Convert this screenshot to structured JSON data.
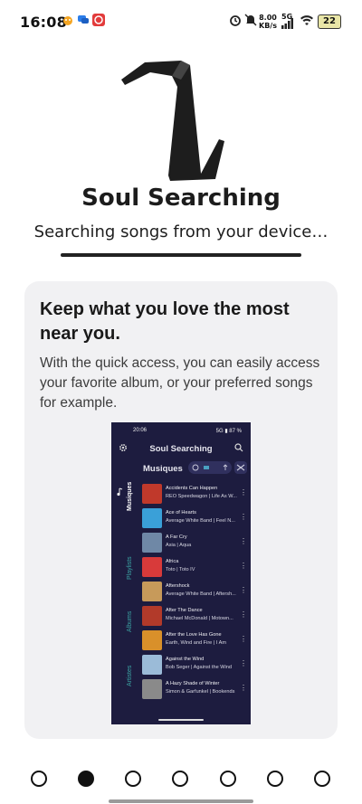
{
  "status_bar": {
    "time": "16:08",
    "net_speed_value": "8.00",
    "net_speed_unit": "KB/s",
    "signal_label": "5G",
    "battery": "22"
  },
  "header": {
    "app_title": "Soul Searching",
    "subtitle": "Searching songs from your device…"
  },
  "card": {
    "title": "Keep what you love the most near you.",
    "description": "With the quick access, you can easily access your favorite album, or your preferred songs for example."
  },
  "preview": {
    "status_time": "20:06",
    "status_right": "5G ▮ 87 %",
    "app_title": "Soul Searching",
    "section_title": "Musiques",
    "side_tabs": [
      "Musiques",
      "Playlists",
      "Albums",
      "Artistes"
    ],
    "songs": [
      {
        "title": "Accidents Can Happen",
        "subtitle": "REO Speedwagon | Life As W...",
        "color": "#c0392b"
      },
      {
        "title": "Ace of Hearts",
        "subtitle": "Average White Band | Feel N...",
        "color": "#3aa0d8"
      },
      {
        "title": "A Far Cry",
        "subtitle": "Asia | Aqua",
        "color": "#6f88a6"
      },
      {
        "title": "Africa",
        "subtitle": "Toto | Toto IV",
        "color": "#d83a3a"
      },
      {
        "title": "Aftershock",
        "subtitle": "Average White Band | Aftersh...",
        "color": "#c79a5a"
      },
      {
        "title": "After The Dance",
        "subtitle": "Michael McDonald | Motown...",
        "color": "#b23a2a"
      },
      {
        "title": "After the Love Has Gone",
        "subtitle": "Earth, Wind and Fire | I Am",
        "color": "#d9902a"
      },
      {
        "title": "Against the Wind",
        "subtitle": "Bob Seger | Against the Wind",
        "color": "#9bbbd8"
      },
      {
        "title": "A Hazy Shade of Winter",
        "subtitle": "Simon & Garfunkel | Bookends",
        "color": "#8a8a8a"
      }
    ]
  },
  "pager": {
    "count": 7,
    "active_index": 1
  },
  "colors": {
    "accent": "#111111",
    "card_bg": "#f1f1f3",
    "preview_bg": "#1d1c3f"
  }
}
